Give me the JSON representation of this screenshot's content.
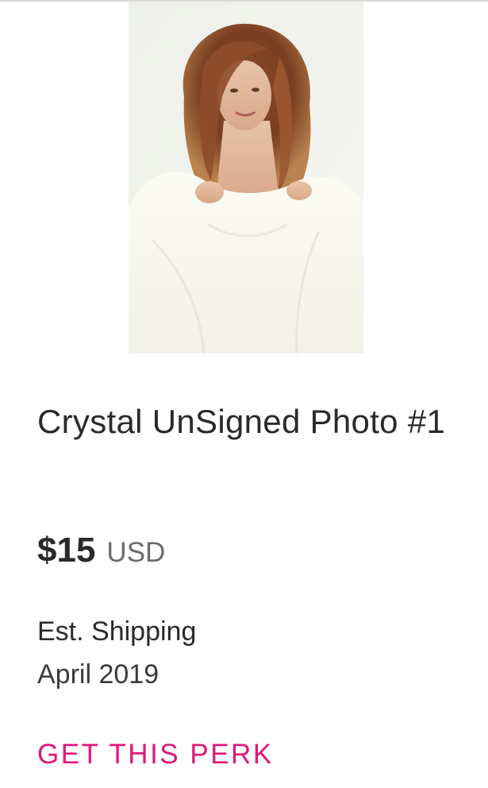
{
  "perk": {
    "title": "Crystal UnSigned Photo #1",
    "price": {
      "amount": "$15",
      "currency": "USD"
    },
    "shipping": {
      "label": "Est. Shipping",
      "date": "April 2019"
    },
    "cta_label": "GET THIS PERK"
  },
  "colors": {
    "accent": "#e0187a",
    "text_primary": "#2a2a2a",
    "text_secondary": "#6b6b6b"
  }
}
